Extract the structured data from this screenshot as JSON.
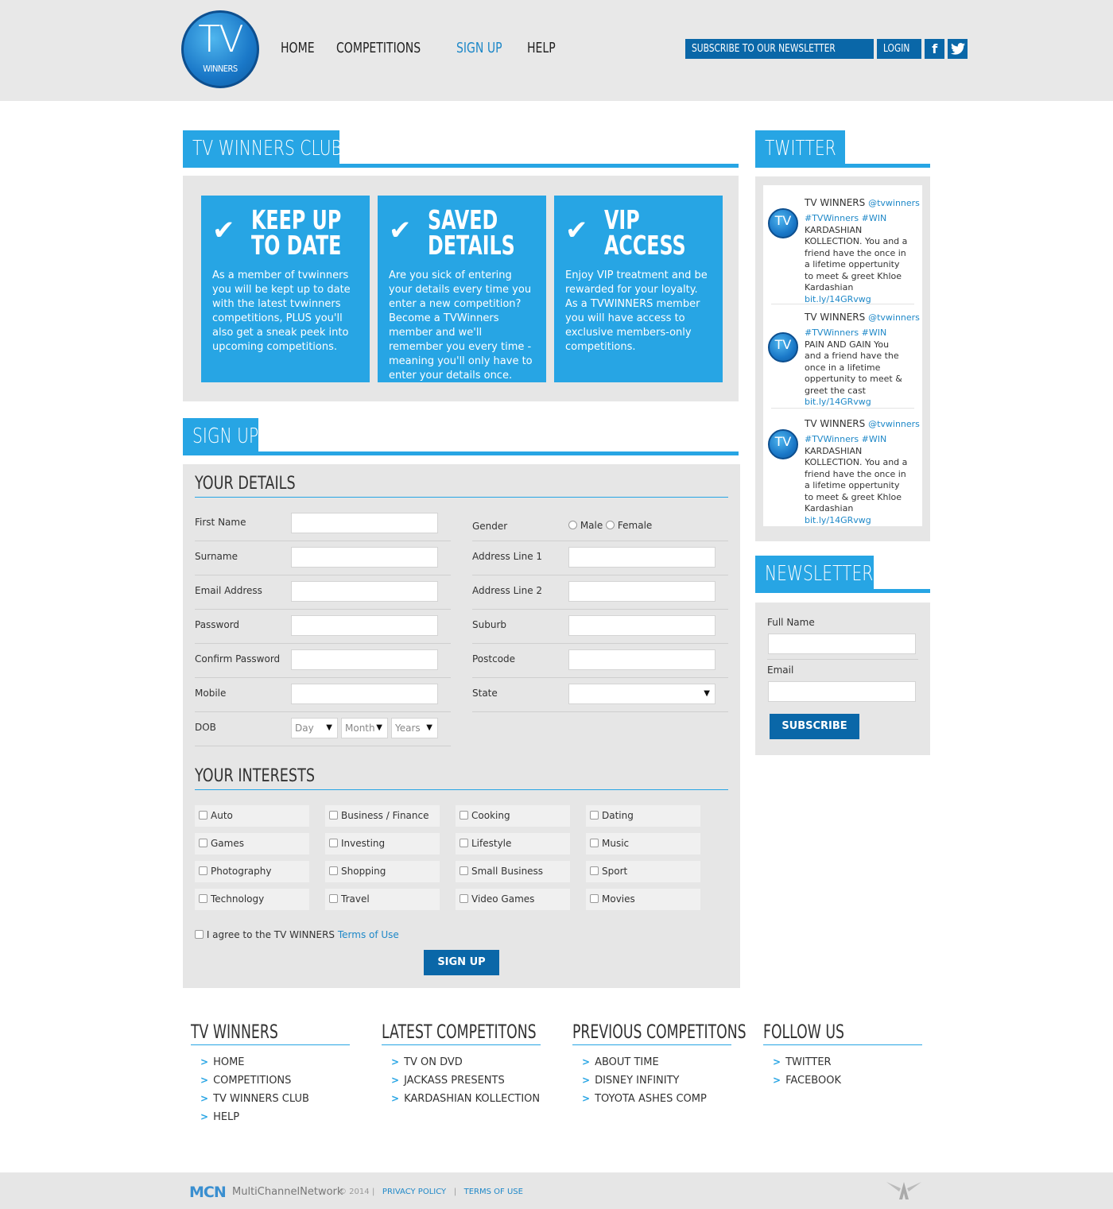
{
  "header": {
    "logo_tv": "TV",
    "logo_winners": "WINNERS",
    "nav": [
      "HOME",
      "COMPETITIONS",
      "SIGN UP",
      "HELP"
    ],
    "active_nav": "SIGN UP",
    "subscribe": "SUBSCRIBE TO OUR NEWSLETTER",
    "login": "LOGIN",
    "facebook": "f",
    "twitter": "t"
  },
  "club": {
    "title": "TV WINNERS CLUB",
    "features": [
      {
        "title": "KEEP UP\nTO DATE",
        "text": "As a member of tvwinners you will be kept up to date with the latest tvwinners competitions, PLUS you'll also get a sneak peek into upcoming competitions."
      },
      {
        "title": "SAVED\nDETAILS",
        "text": "Are you sick of entering your details every time you enter a new competition? Become a TVWinners member and we'll remember you every time - meaning you'll only have to enter your details once."
      },
      {
        "title": "VIP\nACCESS",
        "text": "Enjoy VIP treatment and be rewarded for your loyalty. As a TVWINNERS member you will have access to exclusive members-only competitions."
      }
    ]
  },
  "signup": {
    "title": "SIGN UP",
    "your_details": "YOUR DETAILS",
    "left_fields": [
      "First Name",
      "Surname",
      "Email Address",
      "Password",
      "Confirm Password",
      "Mobile",
      "DOB"
    ],
    "dob": {
      "day": "Day",
      "month": "Month",
      "years": "Years"
    },
    "gender_label": "Gender",
    "gender_male": "Male",
    "gender_female": "Female",
    "right_fields": [
      "Address Line 1",
      "Address Line 2",
      "Suburb",
      "Postcode",
      "State"
    ],
    "your_interests": "YOUR INTERESTS",
    "interests": [
      "Auto",
      "Business / Finance",
      "Cooking",
      "Dating",
      "Games",
      "Investing",
      "Lifestyle",
      "Music",
      "Photography",
      "Shopping",
      "Small Business",
      "Sport",
      "Technology",
      "Travel",
      "Video Games",
      "Movies"
    ],
    "agree_text": "I agree to the TV WINNERS",
    "terms": "Terms of Use",
    "submit": "SIGN UP"
  },
  "twitter": {
    "title": "TWITTER",
    "tweets": [
      {
        "name": "TV WINNERS",
        "handle": "@tvwinners",
        "tags": "#TVWinners #WIN",
        "text": "KARDASHIAN KOLLECTION. You and a friend have the once in a lifetime oppertunity to meet & greet Khloe Kardashian",
        "link": "bit.ly/14GRvwg"
      },
      {
        "name": "TV WINNERS",
        "handle": "@tvwinners",
        "tags": "#TVWinners #WIN",
        "text": "PAIN AND GAIN You and a friend have the once in a lifetime oppertunity to meet & greet the cast",
        "link": "bit.ly/14GRvwg"
      },
      {
        "name": "TV WINNERS",
        "handle": "@tvwinners",
        "tags": "#TVWinners #WIN",
        "text": "KARDASHIAN KOLLECTION. You and a friend have the once in a lifetime oppertunity to meet & greet Khloe Kardashian",
        "link": "bit.ly/14GRvwg"
      }
    ]
  },
  "newsletter": {
    "title": "NEWSLETTER",
    "full_name": "Full Name",
    "email": "Email",
    "submit": "SUBSCRIBE"
  },
  "footer": {
    "cols": [
      {
        "title": "TV WINNERS",
        "links": [
          "HOME",
          "COMPETITIONS",
          "TV WINNERS CLUB",
          "HELP"
        ]
      },
      {
        "title": "LATEST COMPETITONS",
        "links": [
          "TV ON DVD",
          "JACKASS PRESENTS",
          "KARDASHIAN KOLLECTION"
        ]
      },
      {
        "title": "PREVIOUS COMPETITONS",
        "links": [
          "ABOUT TIME",
          "DISNEY INFINITY",
          "TOYOTA ASHES COMP"
        ]
      },
      {
        "title": "FOLLOW US",
        "links": [
          "TWITTER",
          "FACEBOOK"
        ]
      }
    ],
    "mcn": "MCN",
    "mcn_name": "MultiChannelNetwork",
    "copyright": "© 2014",
    "privacy": "PRIVACY POLICY",
    "terms": "TERMS OF USE",
    "sep": "|"
  },
  "colors": {
    "accent": "#27a5e4",
    "dark_blue": "#0a67a8",
    "panel": "#e6e6e6"
  }
}
